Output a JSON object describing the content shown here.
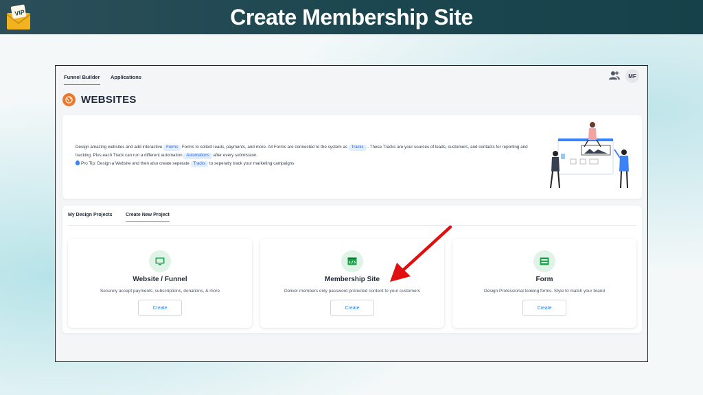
{
  "banner": {
    "title": "Create Membership Site"
  },
  "nav": {
    "tabs": [
      {
        "label": "Funnel Builder",
        "active": true
      },
      {
        "label": "Applications",
        "active": false
      }
    ],
    "avatar_initials": "MF"
  },
  "page": {
    "title": "WEBSITES"
  },
  "intro": {
    "t1": "Design amazing websites and add interactive",
    "chip_forms": "Forms",
    "t2": "Forms to collect leads, payments, and more. All Forms are connected to the system as",
    "chip_tracks": "Tracks",
    "t3": ". These Tracks are your sources of leads, customers, and contacts for reporting and tracking. Plus each Track can run a different automation",
    "chip_automations": "Automations",
    "t4": "after every submission.",
    "tip_prefix": "Pro Tip: Design a Website and then also create seperate",
    "chip_tracks2": "Tracks",
    "tip_suffix": "to seperatly track your marketing campaigns"
  },
  "projects": {
    "tabs": [
      {
        "label": "My Design Projects",
        "active": false
      },
      {
        "label": "Create New Project",
        "active": true
      }
    ],
    "options": [
      {
        "title": "Website / Funnel",
        "description": "Securely accept payments, subscriptions, donations, & more",
        "button": "Create",
        "icon": "monitor-icon"
      },
      {
        "title": "Membership Site",
        "description": "Deliver members only password protected content to your customers",
        "button": "Create",
        "icon": "code-window-icon"
      },
      {
        "title": "Form",
        "description": "Design Professional looking forms. Style to match your brand",
        "button": "Create",
        "icon": "form-icon"
      }
    ]
  },
  "colors": {
    "accent": "#2d7fd3",
    "icon_green": "#1aa34a",
    "arrow": "#e01010",
    "banner": "#1d4750"
  }
}
